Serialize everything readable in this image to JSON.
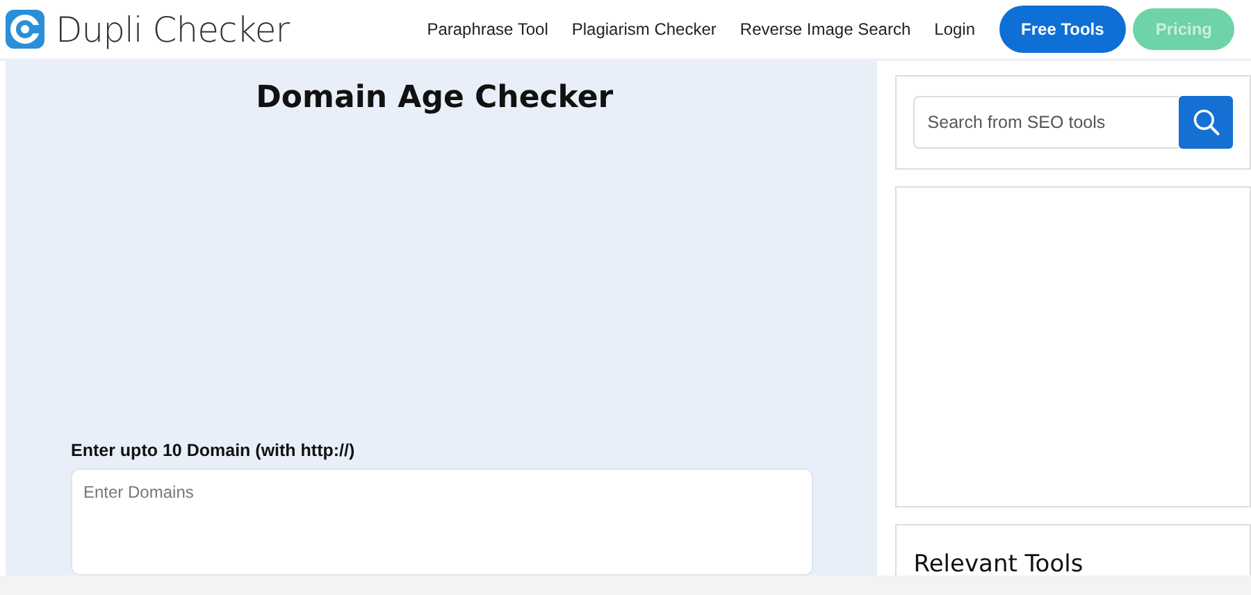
{
  "header": {
    "logo_text": "Dupli Checker",
    "nav": [
      "Paraphrase Tool",
      "Plagiarism Checker",
      "Reverse Image Search",
      "Login"
    ],
    "buttons": [
      {
        "label": "Free Tools",
        "kind": "primary"
      },
      {
        "label": "Pricing",
        "kind": "faded"
      }
    ]
  },
  "main": {
    "title": "Domain Age Checker",
    "field_label": "Enter upto 10 Domain (with http://)",
    "field": {
      "placeholder": "Enter Domains"
    }
  },
  "sidebar": {
    "search": {
      "placeholder": "Search from SEO tools"
    },
    "relevant_title": "Relevant Tools"
  }
}
